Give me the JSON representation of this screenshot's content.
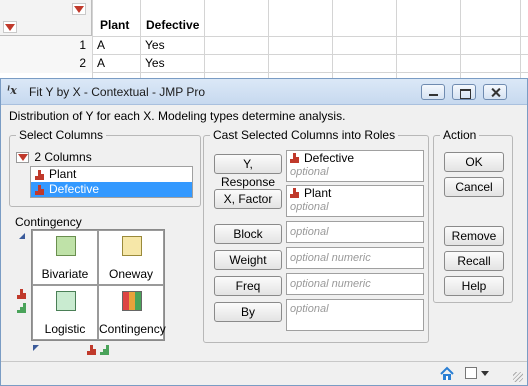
{
  "data_table": {
    "columns": [
      "Plant",
      "Defective"
    ],
    "rows": [
      {
        "num": "1",
        "plant": "A",
        "defective": "Yes"
      },
      {
        "num": "2",
        "plant": "A",
        "defective": "Yes"
      }
    ]
  },
  "dialog": {
    "title": "Fit Y by X - Contextual - JMP Pro",
    "title_icon_text": "ˡx",
    "description": "Distribution of Y for each X. Modeling types determine analysis.",
    "select_columns": {
      "label": "Select Columns",
      "count_label": "2 Columns",
      "items": [
        {
          "label": "Plant",
          "selected": false
        },
        {
          "label": "Defective",
          "selected": true
        }
      ]
    },
    "platforms": {
      "current": "Contingency",
      "items": [
        {
          "label": "Bivariate"
        },
        {
          "label": "Oneway"
        },
        {
          "label": "Logistic"
        },
        {
          "label": "Contingency"
        }
      ]
    },
    "cast_roles": {
      "label": "Cast Selected Columns into Roles",
      "roles": [
        {
          "button": "Y, Response",
          "value": "Defective",
          "hint": "optional"
        },
        {
          "button": "X, Factor",
          "value": "Plant",
          "hint": "optional"
        },
        {
          "button": "Block",
          "value": "",
          "hint": "optional"
        },
        {
          "button": "Weight",
          "value": "",
          "hint": "optional numeric"
        },
        {
          "button": "Freq",
          "value": "",
          "hint": "optional numeric"
        },
        {
          "button": "By",
          "value": "",
          "hint": "optional"
        }
      ]
    },
    "action": {
      "label": "Action",
      "buttons": [
        "OK",
        "Cancel",
        "Remove",
        "Recall",
        "Help"
      ]
    }
  },
  "colors": {
    "selection": "#3399ff",
    "nominal_icon": "#c0392b",
    "title_bar": "#c7d9ef"
  }
}
